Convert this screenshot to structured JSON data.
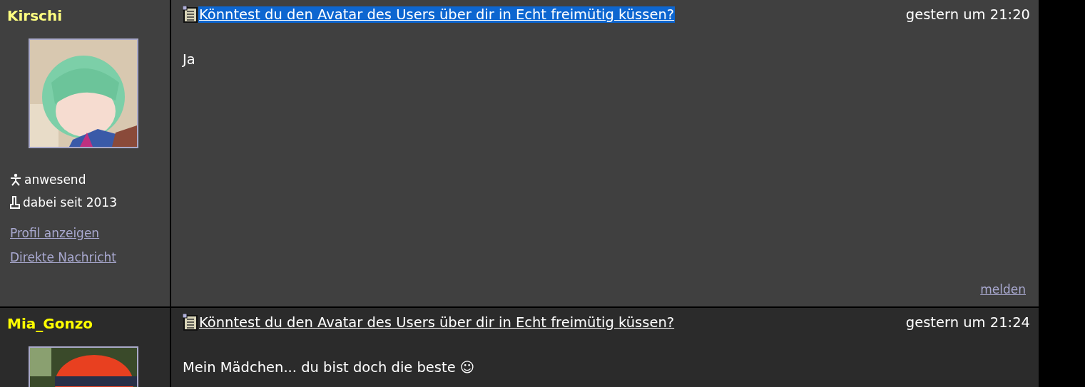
{
  "posts": [
    {
      "author": {
        "name": "Kirschi",
        "color": "#ffff80",
        "status": "anwesend",
        "member_since": "dabei seit 2013",
        "links": [
          "Profil anzeigen",
          "Direkte Nachricht"
        ]
      },
      "title": "Könntest du den Avatar des Users über dir in Echt freimütig küssen?",
      "highlighted": true,
      "time": "gestern um 21:20",
      "body": "Ja",
      "report": "melden"
    },
    {
      "author": {
        "name": "Mia_Gonzo",
        "color": "#ffff00"
      },
      "title": "Könntest du den Avatar des Users über dir in Echt freimütig küssen?",
      "highlighted": false,
      "time": "gestern um 21:24",
      "body": "Mein Mädchen... du bist doch die beste ☺"
    }
  ]
}
